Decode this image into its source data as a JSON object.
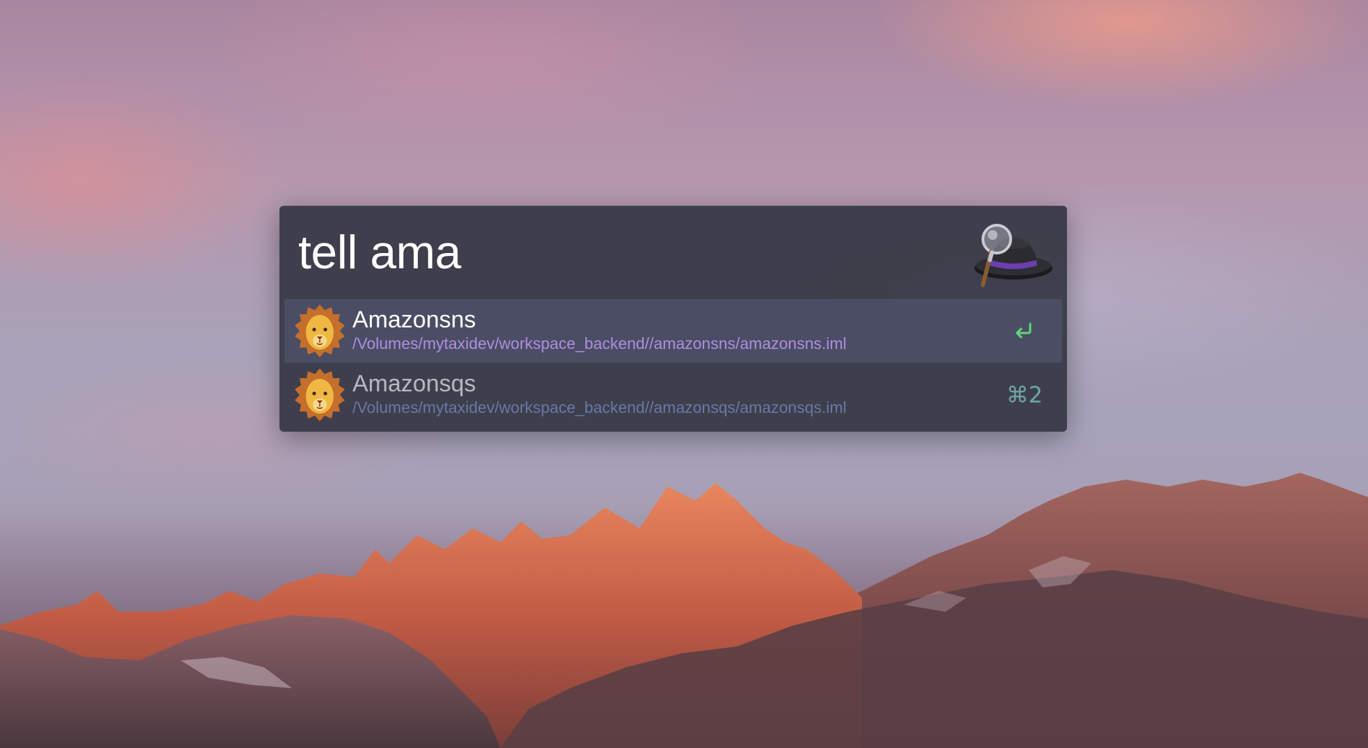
{
  "alfred": {
    "query": "tell ama",
    "logo_icon": "alfred-hat-magnifier-icon",
    "results": [
      {
        "title": "Amazonsns",
        "subtitle": "/Volumes/mytaxidev/workspace_backend//amazonsns/amazonsns.iml",
        "icon": "lion-icon",
        "selected": true,
        "action_icon": "return-key-icon"
      },
      {
        "title": "Amazonsqs",
        "subtitle": "/Volumes/mytaxidev/workspace_backend//amazonsqs/amazonsqs.iml",
        "icon": "lion-icon",
        "selected": false,
        "shortcut": "⌘2"
      }
    ]
  },
  "colors": {
    "window_bg": "#363744",
    "selected_row": "#4c5068",
    "selected_subtitle": "#b08ee0",
    "dim_subtitle": "#6a77a8",
    "return_icon": "#5fd37a",
    "shortcut": "#6fa6a3"
  }
}
